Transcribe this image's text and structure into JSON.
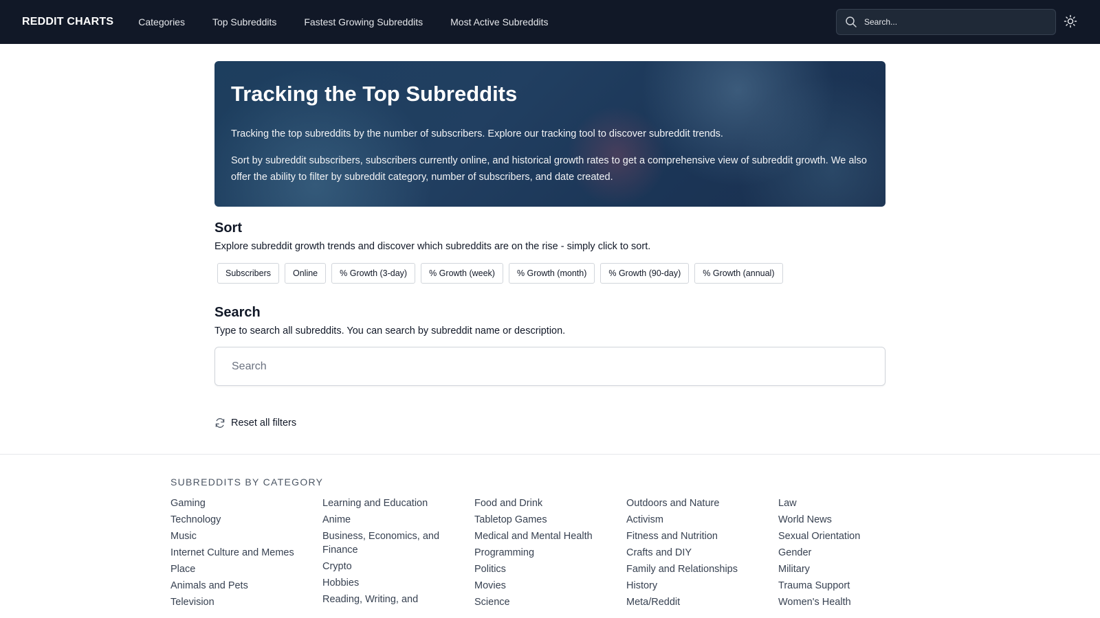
{
  "nav": {
    "brand": "REDDIT CHARTS",
    "links": [
      "Categories",
      "Top Subreddits",
      "Fastest Growing Subreddits",
      "Most Active Subreddits"
    ],
    "search_placeholder": "Search..."
  },
  "hero": {
    "title": "Tracking the Top Subreddits",
    "p1": "Tracking the top subreddits by the number of subscribers. Explore our tracking tool to discover subreddit trends.",
    "p2": "Sort by subreddit subscribers, subscribers currently online, and historical growth rates to get a comprehensive view of subreddit growth. We also offer the ability to filter by subreddit category, number of subscribers, and date created."
  },
  "sort": {
    "title": "Sort",
    "desc": "Explore subreddit growth trends and discover which subreddits are on the rise - simply click to sort.",
    "buttons": [
      "Subscribers",
      "Online",
      "% Growth (3-day)",
      "% Growth (week)",
      "% Growth (month)",
      "% Growth (90-day)",
      "% Growth (annual)"
    ]
  },
  "search": {
    "title": "Search",
    "desc": "Type to search all subreddits. You can search by subreddit name or description.",
    "placeholder": "Search"
  },
  "reset": {
    "label": "Reset all filters"
  },
  "footer": {
    "title": "SUBREDDITS BY CATEGORY",
    "columns": [
      [
        "Gaming",
        "Technology",
        "Music",
        "Internet Culture and Memes",
        "Place",
        "Animals and Pets",
        "Television"
      ],
      [
        "Learning and Education",
        "Anime",
        "Business, Economics, and Finance",
        "Crypto",
        "Hobbies",
        "Reading, Writing, and"
      ],
      [
        "Food and Drink",
        "Tabletop Games",
        "Medical and Mental Health",
        "Programming",
        "Politics",
        "Movies",
        "Science"
      ],
      [
        "Outdoors and Nature",
        "Activism",
        "Fitness and Nutrition",
        "Crafts and DIY",
        "Family and Relationships",
        "History",
        "Meta/Reddit"
      ],
      [
        "Law",
        "World News",
        "Sexual Orientation",
        "Gender",
        "Military",
        "Trauma Support",
        "Women's Health"
      ]
    ]
  }
}
